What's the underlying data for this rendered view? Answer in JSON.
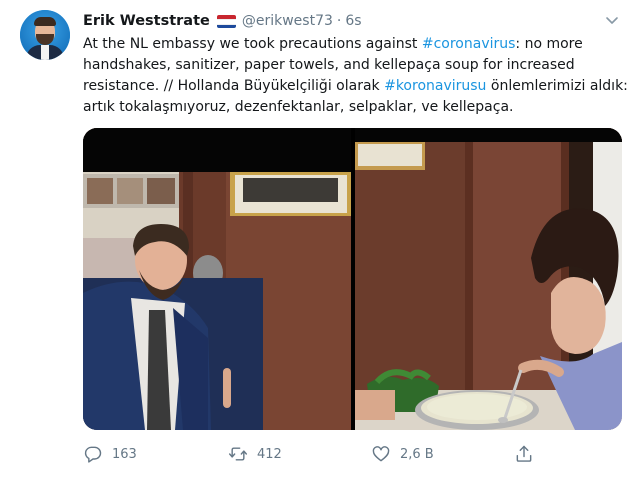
{
  "user": {
    "name": "Erik Weststrate",
    "handle": "@erikwest73",
    "separator": "·",
    "time": "6s"
  },
  "tweet": {
    "line1_a": "At the NL embassy we took precautions against ",
    "line1_tag": "#coronavirus",
    "line1_b": ": no more",
    "line2": "handshakes, sanitizer, paper towels, and kellepaça soup for increased",
    "line3_a": "resistance. // Hollanda Büyükelçiliği olarak ",
    "line3_tag": "#koronavirusu",
    "line3_b": " önlemlerimizi aldık:",
    "line4": "artık tokalaşmıyoruz, dezenfektanlar, selpaklar, ve kellepaça."
  },
  "actions": {
    "replies": "163",
    "retweets": "412",
    "likes": "2,6 B"
  },
  "icons": {
    "caret": "chevron-down-icon",
    "reply": "reply-icon",
    "retweet": "retweet-icon",
    "like": "heart-icon",
    "share": "share-icon",
    "flag": "netherlands-flag-icon"
  },
  "colors": {
    "hashtag": "#1b95e0",
    "secondary_text": "#657786"
  }
}
